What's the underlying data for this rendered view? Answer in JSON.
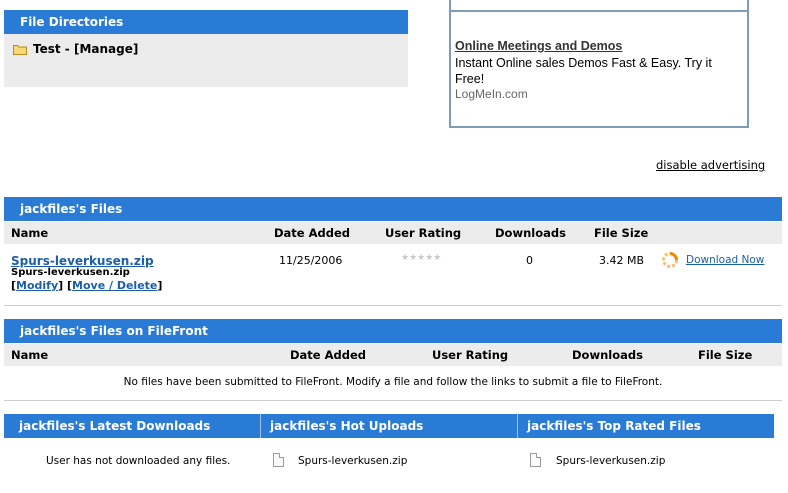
{
  "directories": {
    "header": "File Directories",
    "item_name": "Test - ",
    "item_manage": "[Manage]"
  },
  "ad": {
    "title": "Online Meetings and Demos",
    "text": "Instant Online sales Demos Fast & Easy. Try it Free!",
    "source": "LogMeIn.com"
  },
  "disable_ads": "disable advertising",
  "files": {
    "header": "jackfiles's Files",
    "columns": [
      "Name",
      "Date Added",
      "User Rating",
      "Downloads",
      "File Size"
    ],
    "row": {
      "link": "Spurs-leverkusen.zip",
      "subname": "Spurs-leverkusen.zip",
      "bracket_open": "[",
      "modify": "Modify",
      "mid": "] [",
      "move_delete": "Move / Delete",
      "bracket_close": "]",
      "date": "11/25/2006",
      "rating_stars": "★★★★★",
      "downloads": "0",
      "size": "3.42 MB",
      "download_now": "Download Now"
    }
  },
  "filefront": {
    "header": "jackfiles's Files on FileFront",
    "columns": [
      "Name",
      "Date Added",
      "User Rating",
      "Downloads",
      "File Size"
    ],
    "empty": "No files have been submitted to FileFront. Modify a file and follow the links to submit a file to FileFront."
  },
  "bottom": {
    "latest": {
      "header": "jackfiles's Latest Downloads",
      "text": "User has not downloaded any files."
    },
    "hot": {
      "header": "jackfiles's Hot Uploads",
      "file": "Spurs-leverkusen.zip"
    },
    "top": {
      "header": "jackfiles's Top Rated Files",
      "file": "Spurs-leverkusen.zip"
    }
  },
  "colors": {
    "header_blue": "#2a7bd5",
    "gray_bar": "#ececec",
    "link": "#1a5fa8",
    "ad_border": "#7f9db9"
  }
}
